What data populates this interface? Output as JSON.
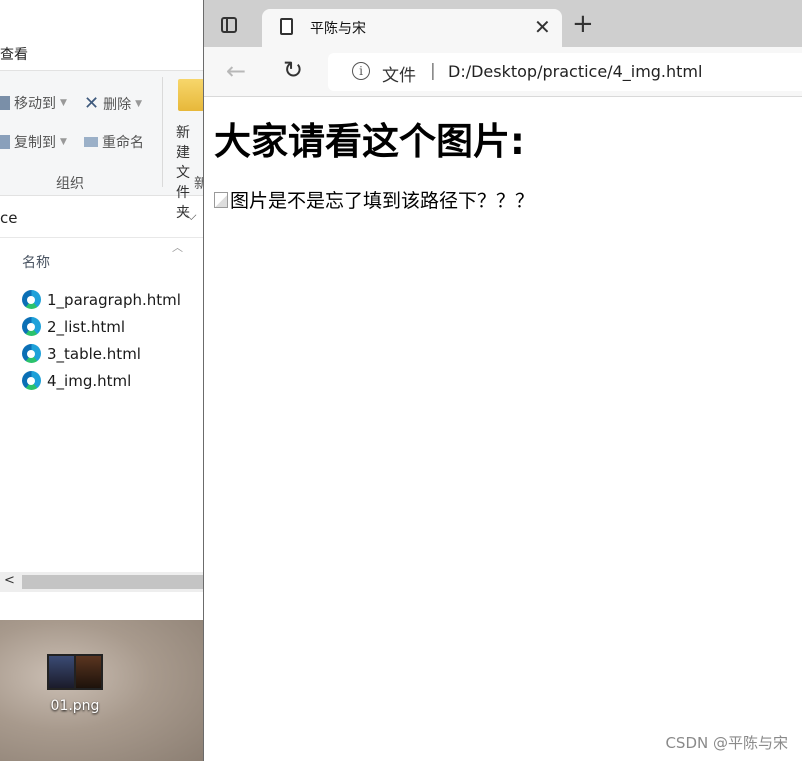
{
  "explorer": {
    "menu_view": "查看",
    "ribbon": {
      "move_to": "移动到",
      "copy_to": "复制到",
      "delete": "删除",
      "rename": "重命名",
      "group_organize": "组织",
      "new_folder_line1": "新建",
      "new_folder_line2": "文件夹",
      "group_new": "新"
    },
    "address_tail": "ce",
    "column_name": "名称",
    "files": [
      {
        "name": "1_paragraph.html",
        "icon": "edge-html-icon"
      },
      {
        "name": "2_list.html",
        "icon": "edge-html-icon"
      },
      {
        "name": "3_table.html",
        "icon": "edge-html-icon"
      },
      {
        "name": "4_img.html",
        "icon": "edge-html-icon"
      }
    ]
  },
  "desktop": {
    "icon_label": "01.png"
  },
  "browser": {
    "tab_title": "平陈与宋",
    "url_label": "文件",
    "url": "D:/Desktop/practice/4_img.html",
    "page": {
      "heading": "大家请看这个图片:",
      "image_alt": "图片是不是忘了填到该路径下？？？"
    }
  },
  "watermark": "CSDN @平陈与宋"
}
